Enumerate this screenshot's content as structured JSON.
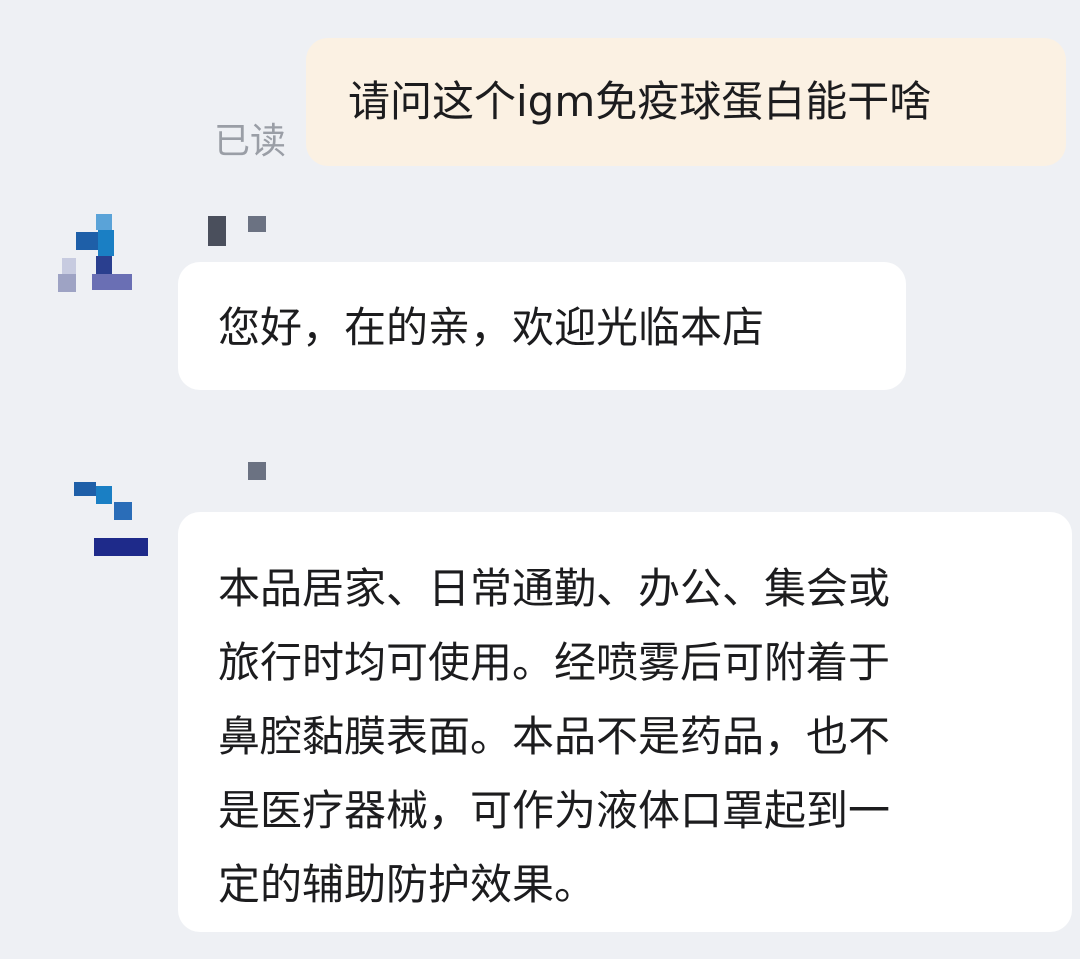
{
  "conversation": {
    "messages": [
      {
        "direction": "outgoing",
        "text": "请问这个igm免疫球蛋白能干啥",
        "status": "已读"
      },
      {
        "direction": "incoming",
        "sender_obscured": true,
        "text": "您好，在的亲，欢迎光临本店"
      },
      {
        "direction": "incoming",
        "sender_obscured": true,
        "text": "本品居家、日常通勤、办公、集会或\n旅行时均可使用。经喷雾后可附着于\n鼻腔黏膜表面。本品不是药品，也不\n是医疗器械，可作为液体口罩起到一\n定的辅助防护效果。"
      }
    ]
  },
  "colors": {
    "background": "#eef0f4",
    "outgoing_bubble": "#fbf1e3",
    "incoming_bubble": "#ffffff",
    "read_status": "#9a9ea6",
    "mosaic_blue": "#1e5fa8",
    "mosaic_navy": "#2a3f8f",
    "mosaic_gray": "#6b7282"
  }
}
